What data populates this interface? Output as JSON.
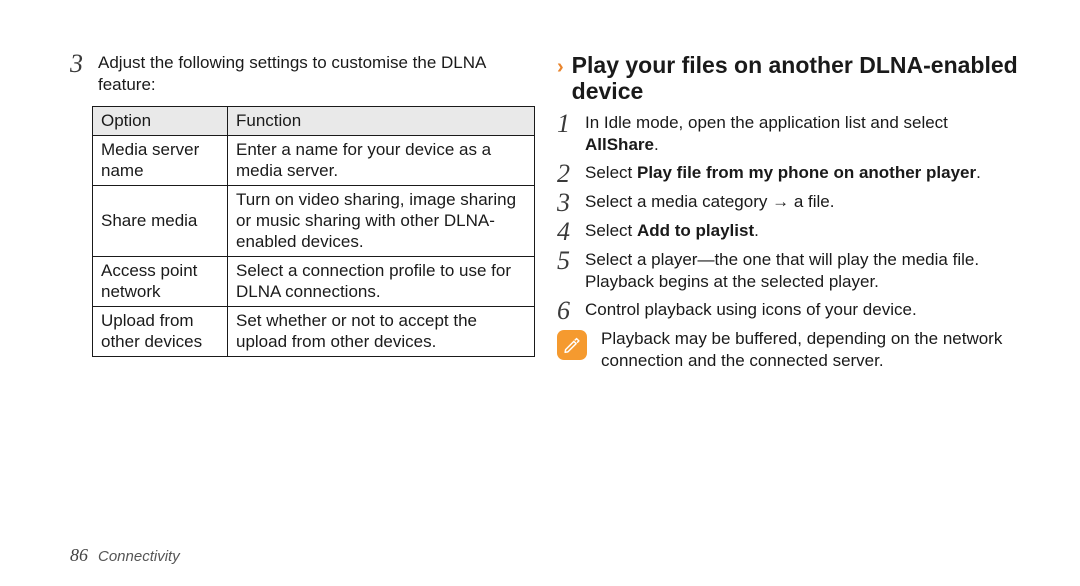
{
  "left": {
    "step3_num": "3",
    "step3_text": "Adjust the following settings to customise the DLNA feature:",
    "table": {
      "header": {
        "option": "Option",
        "function": "Function"
      },
      "rows": [
        {
          "option": "Media server name",
          "function": "Enter a name for your device as a media server."
        },
        {
          "option": "Share media",
          "function": "Turn on video sharing, image sharing or music sharing with other DLNA-enabled devices."
        },
        {
          "option": "Access point network",
          "function": "Select a connection profile to use for DLNA connections."
        },
        {
          "option": "Upload from other devices",
          "function": "Set whether or not to accept the upload from other devices."
        }
      ]
    }
  },
  "right": {
    "heading_chevron": "›",
    "heading": "Play your files on another DLNA-enabled device",
    "steps": [
      {
        "num": "1",
        "pre": "In Idle mode, open the application list and select ",
        "bold": "AllShare",
        "post": "."
      },
      {
        "num": "2",
        "pre": "Select ",
        "bold": "Play file from my phone on another player",
        "post": "."
      },
      {
        "num": "3",
        "pre": "Select a media category → a file.",
        "bold": "",
        "post": ""
      },
      {
        "num": "4",
        "pre": "Select ",
        "bold": "Add to playlist",
        "post": "."
      },
      {
        "num": "5",
        "pre": "Select a player—the one that will play the media file. Playback begins at the selected player.",
        "bold": "",
        "post": ""
      },
      {
        "num": "6",
        "pre": "Control playback using icons of your device.",
        "bold": "",
        "post": ""
      }
    ],
    "note": "Playback may be buffered, depending on the network connection and the connected server."
  },
  "footer": {
    "page_number": "86",
    "section": "Connectivity"
  }
}
